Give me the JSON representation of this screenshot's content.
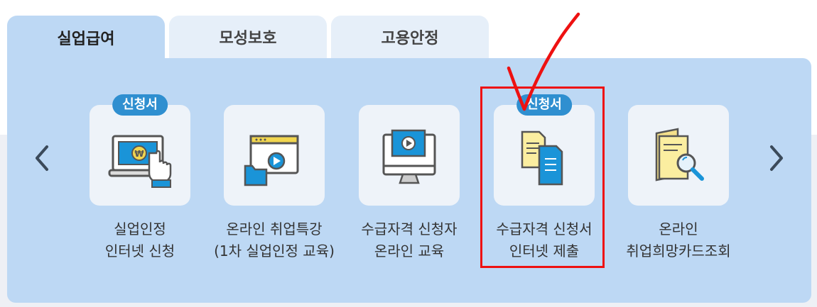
{
  "tabs": [
    {
      "label": "실업급여",
      "active": true
    },
    {
      "label": "모성보호",
      "active": false
    },
    {
      "label": "고용안정",
      "active": false
    }
  ],
  "carousel": {
    "prev_icon": "chevron-left-icon",
    "next_icon": "chevron-right-icon",
    "items": [
      {
        "badge": "신청서",
        "line1": "실업인정",
        "line2": "인터넷 신청",
        "icon": "laptop-payment-icon"
      },
      {
        "badge": "",
        "line1": "온라인 취업특강",
        "line2": "(1차 실업인정 교육)",
        "icon": "video-folder-icon"
      },
      {
        "badge": "",
        "line1": "수급자격 신청자",
        "line2": "온라인 교육",
        "icon": "monitor-play-icon"
      },
      {
        "badge": "신청서",
        "line1": "수급자격 신청서",
        "line2": "인터넷 제출",
        "icon": "documents-icon"
      },
      {
        "badge": "",
        "line1": "온라인",
        "line2": "취업희망카드조회",
        "icon": "document-search-icon"
      }
    ]
  },
  "colors": {
    "panel": "#bdd8f4",
    "badge": "#2f8fd0",
    "highlight": "#e11111"
  }
}
